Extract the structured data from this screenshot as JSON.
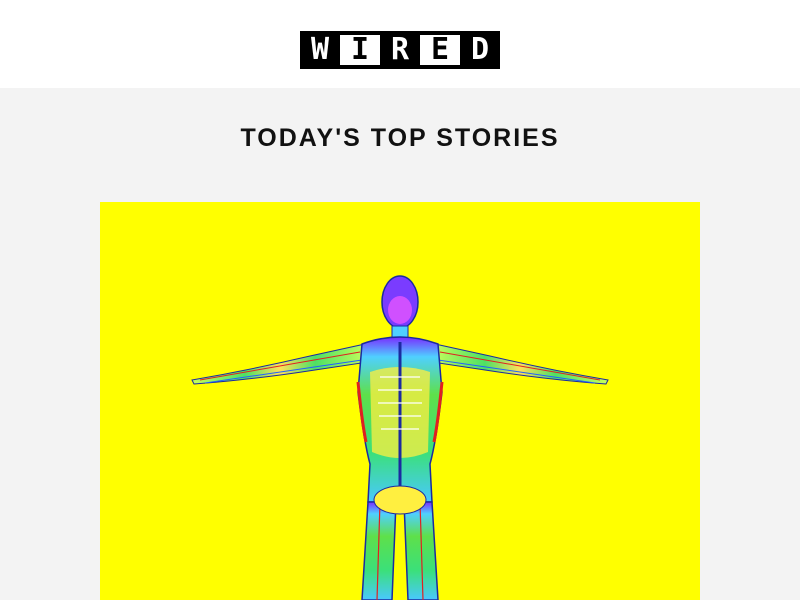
{
  "header": {
    "logo_letters": [
      "W",
      "I",
      "R",
      "E",
      "D"
    ]
  },
  "main": {
    "section_title": "TODAY'S TOP STORIES"
  },
  "hero": {
    "background_color": "#ffff00",
    "image": "anatomy-figure"
  }
}
